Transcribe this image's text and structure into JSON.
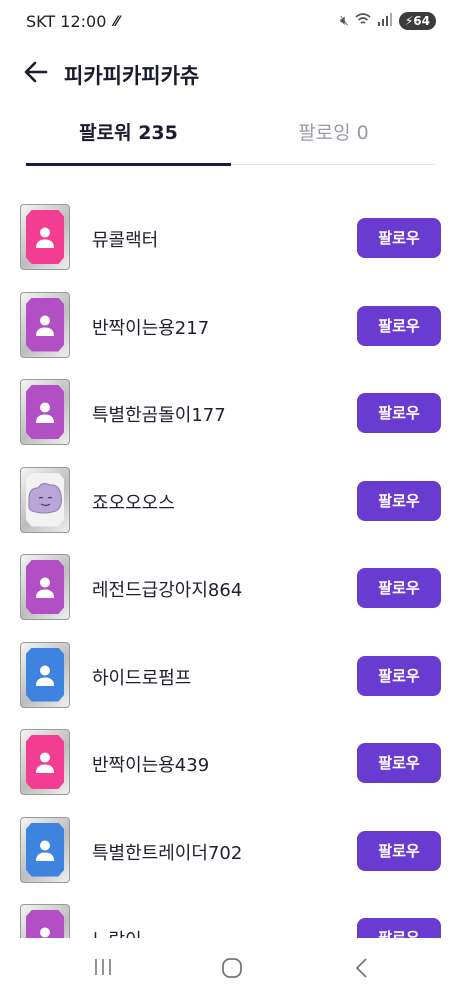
{
  "status_bar": {
    "carrier_time": "SKT 12:00",
    "battery": "64"
  },
  "header": {
    "title": "피카피카피카츄"
  },
  "tabs": [
    {
      "label": "팔로워 235",
      "active": true
    },
    {
      "label": "팔로잉 0",
      "active": false
    }
  ],
  "followers": [
    {
      "name": "뮤콜랙터",
      "color": "#f23d92",
      "avatar": "person-icon",
      "button": "팔로우"
    },
    {
      "name": "반짝이는용217",
      "color": "#b34fc4",
      "avatar": "person-icon",
      "button": "팔로우"
    },
    {
      "name": "특별한곰돌이177",
      "color": "#b34fc4",
      "avatar": "person-icon",
      "button": "팔로우"
    },
    {
      "name": "죠오오오스",
      "color": "#b8a6d8",
      "avatar": "ditto-image",
      "button": "팔로우"
    },
    {
      "name": "레전드급강아지864",
      "color": "#b34fc4",
      "avatar": "person-icon",
      "button": "팔로우"
    },
    {
      "name": "하이드로펌프",
      "color": "#3f83e0",
      "avatar": "person-icon",
      "button": "팔로우"
    },
    {
      "name": "반짝이는용439",
      "color": "#f23d92",
      "avatar": "person-icon",
      "button": "팔로우"
    },
    {
      "name": "특별한트레이더702",
      "color": "#3f83e0",
      "avatar": "person-icon",
      "button": "팔로우"
    },
    {
      "name": "노랑이",
      "color": "#b34fc4",
      "avatar": "person-icon",
      "button": "팔로우"
    }
  ],
  "colors": {
    "accent": "#6a3bd1",
    "tab_underline": "#1c1a3a"
  }
}
